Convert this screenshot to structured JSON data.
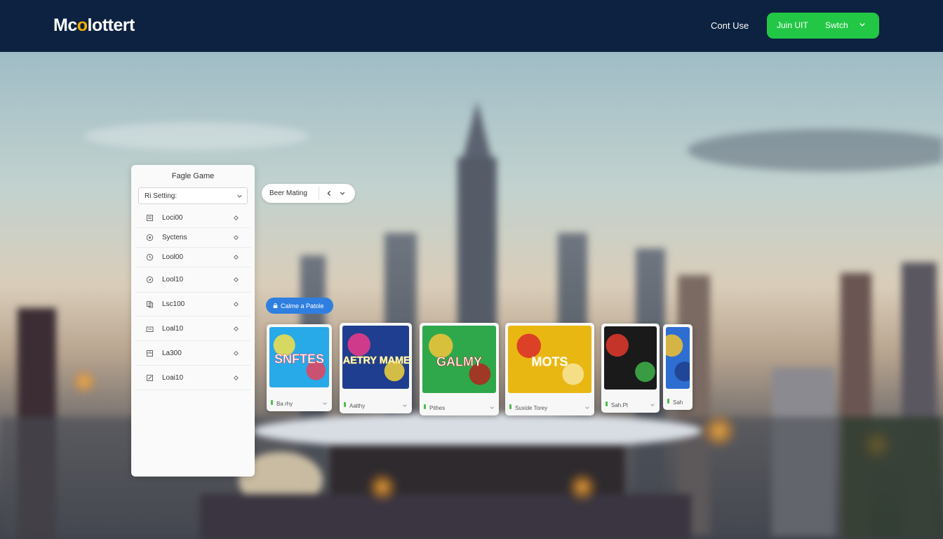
{
  "header": {
    "logo_text": "Mcolottert",
    "nav_link": "Cont Use",
    "cta_left": "Juin UIT",
    "cta_right": "Swtch"
  },
  "panel": {
    "title": "Fagle Game",
    "select_label": "Ri Setting:",
    "items": [
      {
        "label": "Loci00",
        "icon": "document-icon"
      },
      {
        "label": "Syctens",
        "icon": "settings-circle-icon"
      },
      {
        "label": "Lool00",
        "icon": "clock-icon"
      },
      {
        "label": "Lool10",
        "icon": "compass-icon"
      },
      {
        "label": "Lsc100",
        "icon": "copy-icon"
      },
      {
        "label": "Loal10",
        "icon": "keyboard-icon"
      },
      {
        "label": "La300",
        "icon": "archive-icon"
      },
      {
        "label": "Loai10",
        "icon": "edit-icon"
      }
    ]
  },
  "filter_pill": {
    "label": "Beer Mating"
  },
  "tag": {
    "label": "Calme a Patole"
  },
  "cards": [
    {
      "title": "Ba rhy",
      "art_text": "SNFTES",
      "colors": [
        "#28a9e8",
        "#f4e14a",
        "#e8425a"
      ]
    },
    {
      "title": "Aalthy",
      "art_text": "MAETRY MAMES",
      "colors": [
        "#1f3e8f",
        "#ef3b8a",
        "#f5d33a"
      ]
    },
    {
      "title": "Pithes",
      "art_text": "GALMY",
      "colors": [
        "#2ea84a",
        "#f3c43a",
        "#b3241f"
      ]
    },
    {
      "title": "Suxide Torey",
      "art_text": "MOTS",
      "colors": [
        "#e9b712",
        "#d92b2b",
        "#f7e69b"
      ]
    },
    {
      "title": "Sah.Pt",
      "art_text": "",
      "colors": [
        "#1a1a1a",
        "#e33a2c",
        "#3fb34a"
      ]
    },
    {
      "title": "Sah",
      "art_text": "",
      "colors": [
        "#2f6ed1",
        "#f2c12e",
        "#1d3f8e"
      ]
    }
  ],
  "colors": {
    "header_bg": "#0d2140",
    "accent_green": "#23c746",
    "accent_blue": "#2f7fe0",
    "logo_accent": "#f4b000"
  }
}
